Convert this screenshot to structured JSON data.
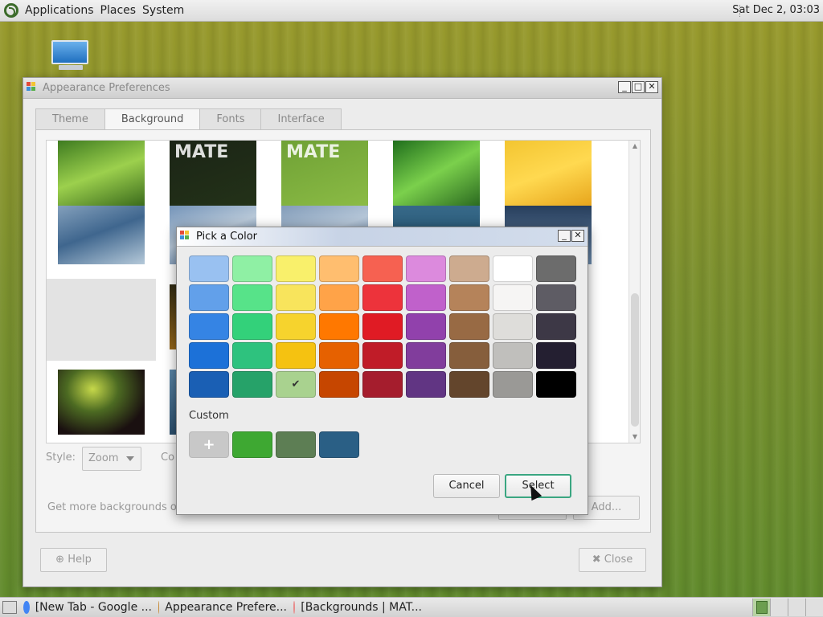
{
  "top_panel": {
    "menus": [
      "Applications",
      "Places",
      "System"
    ],
    "clock": "Sat Dec  2, 03:03"
  },
  "appearance_window": {
    "title": "Appearance Preferences",
    "tabs": [
      "Theme",
      "Background",
      "Fonts",
      "Interface"
    ],
    "active_tab": "Background",
    "style_label": "Style:",
    "style_value": "Zoom",
    "color_label": "Co",
    "more_backgrounds_label": "Get more backgrounds onl",
    "add_button": "Add...",
    "help_button": "Help",
    "close_button": "Close",
    "thumbnails": [
      {
        "row": 0,
        "col": 0,
        "bg": "linear-gradient(160deg,#3e7b20,#9cd04d 50%,#3b6b1c)"
      },
      {
        "row": 0,
        "col": 1,
        "bg": "linear-gradient(160deg,#1b2416,#233218)",
        "text": "MATE"
      },
      {
        "row": 0,
        "col": 2,
        "bg": "linear-gradient(160deg,#6fa135,#8bbb45)",
        "text": "MATE"
      },
      {
        "row": 0,
        "col": 3,
        "bg": "linear-gradient(150deg,#1f6e1c,#7bd04c 50%,#2b6a20)"
      },
      {
        "row": 0,
        "col": 4,
        "bg": "linear-gradient(160deg,#f3c531,#ffd950 50%,#e7a51c)"
      },
      {
        "row": 1,
        "col": 0,
        "bg": "linear-gradient(160deg,#8ea9c3,#3f668e 50%,#b5c9d9)"
      },
      {
        "row": 1,
        "col": 1,
        "bg": "linear-gradient(160deg,#6a8cb4,#b8c8d8 50%,#345c8a)"
      },
      {
        "row": 1,
        "col": 2,
        "bg": "linear-gradient(160deg,#7b96b4,#b5c6d8 50%,#4a6c93)"
      },
      {
        "row": 1,
        "col": 3,
        "bg": "linear-gradient(180deg,#3a6d8d,#1d4a66)"
      },
      {
        "row": 1,
        "col": 4,
        "bg": "linear-gradient(180deg,#1f3552,#6d8db0)"
      },
      {
        "row": 2,
        "col": 0,
        "bg": "repeating-linear-gradient(90deg,#7a9a2c 0,#a6b236 5px,#4f8a2a 11px)",
        "selected": true
      },
      {
        "row": 2,
        "col": 1,
        "bg": "linear-gradient(160deg,#2f2a14,#c8851e)"
      },
      {
        "row": 3,
        "col": 0,
        "bg": "radial-gradient(ellipse at 40% 30%,#c6d84a 0,#4c6a22 35%,#1a1010 75%)"
      },
      {
        "row": 3,
        "col": 1,
        "bg": "linear-gradient(180deg,#5a86a8,#2b4f6d)"
      }
    ]
  },
  "color_picker": {
    "title": "Pick a Color",
    "palette": [
      [
        "#99c1f1",
        "#8ff0a4",
        "#f9f06b",
        "#ffbe6f",
        "#f66151",
        "#dc8add",
        "#cdab8f",
        "#ffffff",
        "#6c6c6c"
      ],
      [
        "#62a0ea",
        "#57e389",
        "#f8e45c",
        "#ffa348",
        "#ed333b",
        "#c061cb",
        "#b5835a",
        "#f6f5f4",
        "#5e5c64"
      ],
      [
        "#3584e4",
        "#33d17a",
        "#f6d32d",
        "#ff7800",
        "#e01b24",
        "#9141ac",
        "#986a44",
        "#deddda",
        "#3d3846"
      ],
      [
        "#1c71d8",
        "#2ec27e",
        "#f5c211",
        "#e66100",
        "#c01c28",
        "#813d9c",
        "#865e3c",
        "#c0bfbc",
        "#241f31"
      ],
      [
        "#1a5fb4",
        "#26a269",
        "#a9d28f",
        "#c64600",
        "#a51d2d",
        "#613583",
        "#63452c",
        "#9a9996",
        "#000000"
      ]
    ],
    "selected": {
      "row": 4,
      "col": 2
    },
    "checkmark": "✔",
    "custom_label": "Custom",
    "add_custom": "+",
    "custom_colors": [
      "#3ea832",
      "#5d7e54",
      "#2a5f85"
    ],
    "cancel_button": "Cancel",
    "select_button": "Select"
  },
  "taskbar": {
    "tasks": [
      {
        "label": "[New Tab - Google ...",
        "icon_color": "#4285f4"
      },
      {
        "label": "Appearance Prefere...",
        "icon_color": "#c98d3b"
      },
      {
        "label": "[Backgrounds | MAT...",
        "icon_color": "#e88a8a"
      }
    ]
  }
}
